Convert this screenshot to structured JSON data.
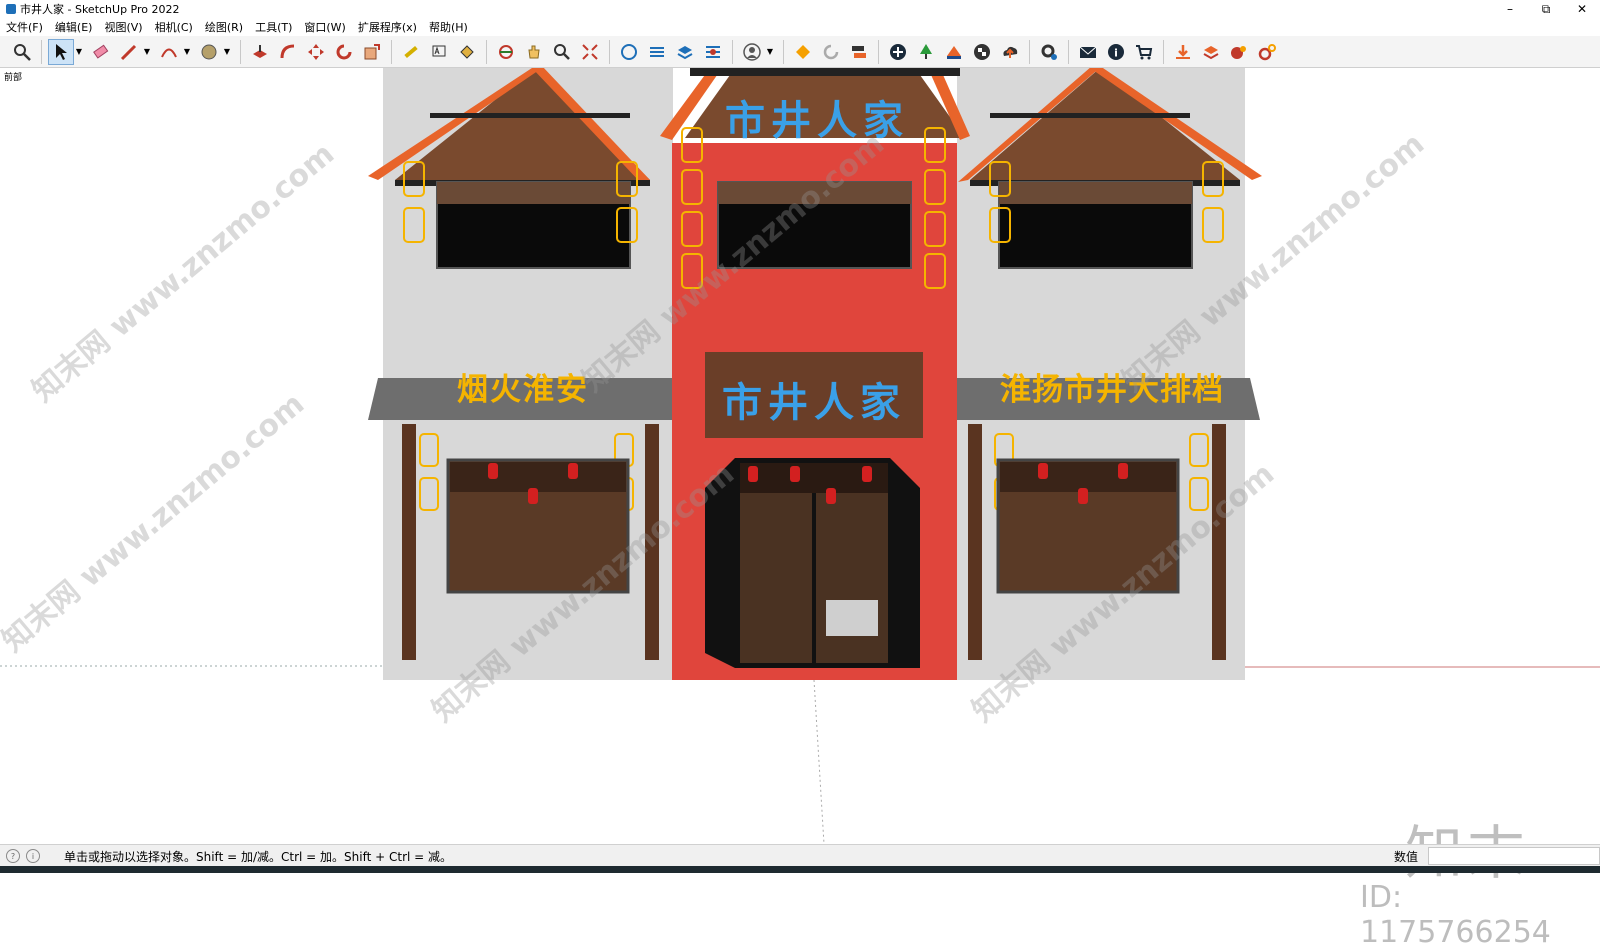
{
  "window": {
    "title": "市井人家 - SketchUp Pro 2022",
    "minimize": "–",
    "restore": "⧉",
    "close": "✕"
  },
  "menu": [
    "文件(F)",
    "编辑(E)",
    "视图(V)",
    "相机(C)",
    "绘图(R)",
    "工具(T)",
    "窗口(W)",
    "扩展程序(x)",
    "帮助(H)"
  ],
  "viewport": {
    "scene_label": "前部",
    "signs": {
      "top_center": "市井人家",
      "middle_center": "市井人家",
      "left_banner": "烟火淮安",
      "right_banner": "淮扬市井大排档"
    },
    "colors": {
      "wall": "#d8d8d8",
      "red": "#e0453c",
      "roof_orange": "#e8642a",
      "roof_wood": "#7a4a2e",
      "sign_blue": "#3aa0e8",
      "sign_yellow": "#f5b400"
    }
  },
  "status": {
    "hint": "单击或拖动以选择对象。Shift = 加/减。Ctrl = 加。Shift + Ctrl = 减。",
    "measure_label": "数值",
    "measure_value": ""
  },
  "watermark": {
    "brand": "知末",
    "id": "ID: 1175766254",
    "diagonal": "知末网 www.znzmo.com"
  }
}
